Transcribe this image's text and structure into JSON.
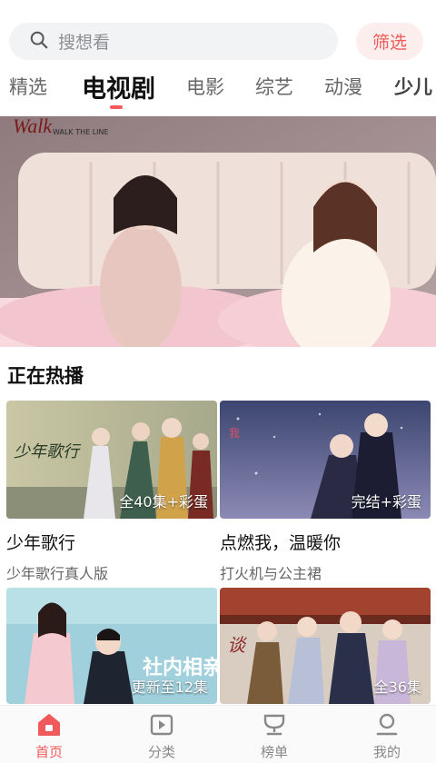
{
  "search": {
    "placeholder": "搜想看",
    "filter_label": "筛选"
  },
  "tabs": [
    {
      "label": "精选"
    },
    {
      "label": "电视剧",
      "active": true
    },
    {
      "label": "电影"
    },
    {
      "label": "综艺"
    },
    {
      "label": "动漫"
    },
    {
      "label": "少儿"
    }
  ],
  "banner": {
    "logo_text": "WALK THE LINE"
  },
  "section": {
    "title": "正在热播"
  },
  "cards": [
    {
      "badge": "全40集+彩蛋",
      "title": "少年歌行",
      "subtitle": "少年歌行真人版",
      "poster_text": "少年歌行"
    },
    {
      "badge": "完结+彩蛋",
      "title": "点燃我，温暖你",
      "subtitle": "打火机与公主裙",
      "poster_text": ""
    },
    {
      "badge": "更新至12集",
      "title": "",
      "subtitle": "",
      "poster_text": "社内相亲"
    },
    {
      "badge": "全36集",
      "title": "",
      "subtitle": "",
      "poster_text": ""
    }
  ],
  "bottom_nav": [
    {
      "label": "首页",
      "icon": "home-icon",
      "active": true
    },
    {
      "label": "分类",
      "icon": "category-icon"
    },
    {
      "label": "榜单",
      "icon": "ranking-icon"
    },
    {
      "label": "我的",
      "icon": "profile-icon"
    }
  ],
  "colors": {
    "accent": "#f15a5a",
    "filter_bg": "#fdeeee",
    "search_bg": "#f2f3f5"
  }
}
